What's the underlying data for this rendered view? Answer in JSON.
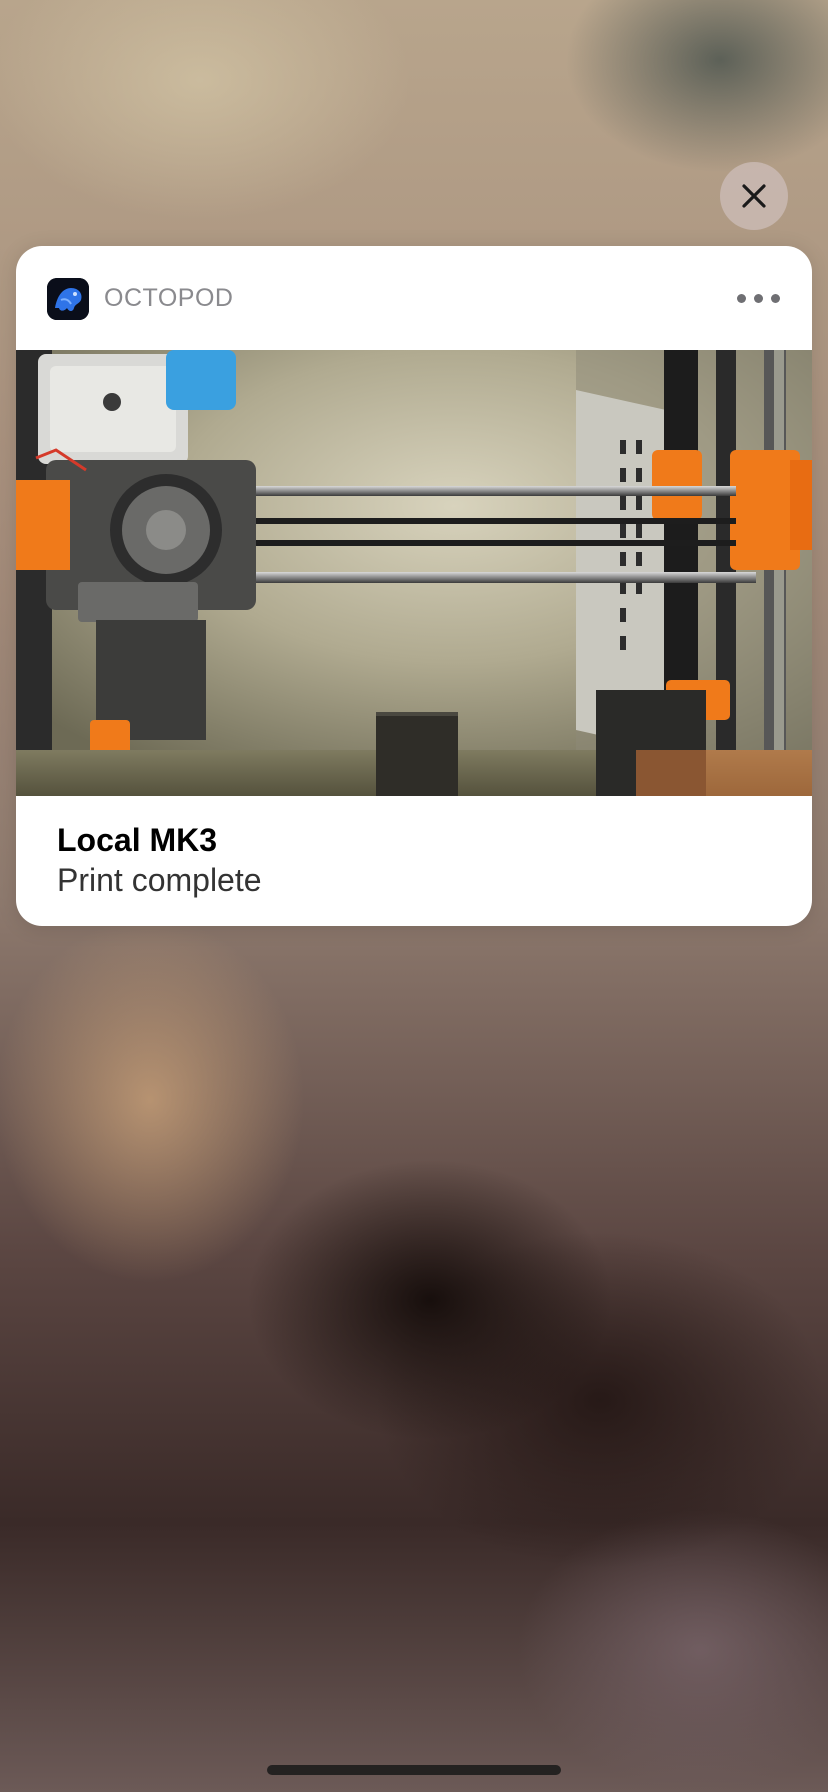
{
  "notification": {
    "app_name": "OCTOPOD",
    "title": "Local MK3",
    "body": "Print complete",
    "attachment": "print-camera-snapshot"
  },
  "icons": {
    "close": "close-icon",
    "more": "more-icon",
    "app": "octopod-app-icon"
  },
  "colors": {
    "card_background": "#ffffff",
    "app_name_text": "#8a8a8e",
    "printer_orange": "#f07a1a"
  }
}
